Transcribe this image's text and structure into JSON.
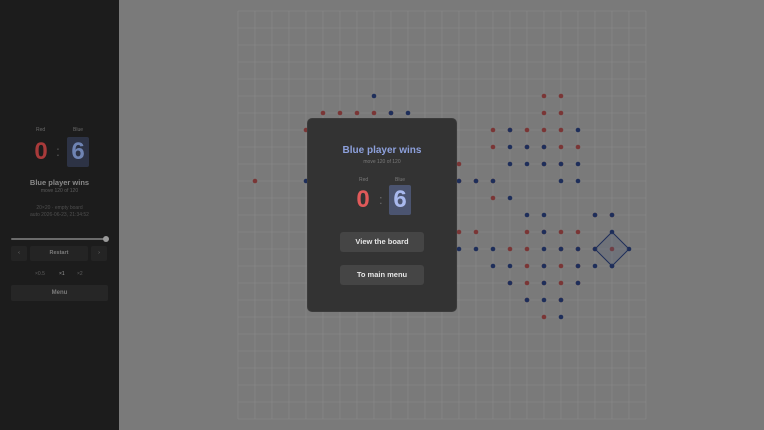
{
  "sidebar": {
    "red_label": "Red",
    "blue_label": "Blue",
    "red_score": "0",
    "blue_score": "6",
    "separator": ":",
    "result": "Blue player wins",
    "move": "move 120 of 120",
    "board_info": "20×20 · empty board",
    "date": "auto 2026-06-23, 21:34:52",
    "slider_value": 1.0,
    "prev": "‹",
    "restart": "Restart",
    "next": "›",
    "speeds": [
      "×0.5",
      "×1",
      "×2"
    ],
    "menu": "Menu"
  },
  "modal": {
    "title": "Blue player wins",
    "move": "move 120 of 120",
    "red_label": "Red",
    "blue_label": "Blue",
    "red_score": "0",
    "blue_score": "6",
    "separator": ":",
    "view_board": "View the board",
    "main_menu": "To main menu"
  },
  "colors": {
    "red_dot": "#7a3636",
    "blue_dot": "#1e2e5a",
    "grid_line": "#8a8a8a",
    "overlay": "#7a7a7a"
  },
  "board": {
    "cols": 24,
    "rows": 24,
    "red_dots": [
      [
        5,
        6
      ],
      [
        6,
        6
      ],
      [
        7,
        6
      ],
      [
        8,
        6
      ],
      [
        9,
        6
      ],
      [
        4,
        7
      ],
      [
        1,
        10
      ],
      [
        13,
        9
      ],
      [
        13,
        10
      ],
      [
        14,
        10
      ],
      [
        15,
        10
      ],
      [
        15,
        11
      ],
      [
        15,
        7
      ],
      [
        16,
        7
      ],
      [
        17,
        7
      ],
      [
        18,
        7
      ],
      [
        19,
        7
      ],
      [
        15,
        8
      ],
      [
        17,
        8
      ],
      [
        18,
        8
      ],
      [
        19,
        8
      ],
      [
        20,
        8
      ],
      [
        18,
        9
      ],
      [
        19,
        9
      ],
      [
        18,
        5
      ],
      [
        19,
        5
      ],
      [
        18,
        6
      ],
      [
        19,
        6
      ],
      [
        13,
        13
      ],
      [
        14,
        13
      ],
      [
        17,
        13
      ],
      [
        18,
        13
      ],
      [
        19,
        13
      ],
      [
        16,
        14
      ],
      [
        17,
        14
      ],
      [
        19,
        14
      ],
      [
        21,
        14
      ],
      [
        17,
        15
      ],
      [
        18,
        15
      ],
      [
        19,
        15
      ],
      [
        20,
        15
      ],
      [
        16,
        16
      ],
      [
        17,
        16
      ],
      [
        18,
        16
      ],
      [
        19,
        16
      ],
      [
        20,
        16
      ],
      [
        17,
        17
      ],
      [
        19,
        17
      ],
      [
        18,
        18
      ],
      [
        21,
        12
      ],
      [
        22,
        12
      ],
      [
        20,
        13
      ],
      [
        20,
        14
      ],
      [
        22,
        14
      ]
    ],
    "blue_dots": [
      [
        8,
        5
      ],
      [
        9,
        6
      ],
      [
        10,
        6
      ],
      [
        4,
        10
      ],
      [
        13,
        10
      ],
      [
        14,
        10
      ],
      [
        15,
        10
      ],
      [
        16,
        8
      ],
      [
        17,
        8
      ],
      [
        18,
        8
      ],
      [
        16,
        9
      ],
      [
        17,
        9
      ],
      [
        18,
        9
      ],
      [
        19,
        9
      ],
      [
        20,
        9
      ],
      [
        16,
        7
      ],
      [
        20,
        7
      ],
      [
        19,
        10
      ],
      [
        20,
        10
      ],
      [
        16,
        11
      ],
      [
        18,
        12
      ],
      [
        17,
        12
      ],
      [
        13,
        14
      ],
      [
        14,
        14
      ],
      [
        15,
        14
      ],
      [
        15,
        15
      ],
      [
        16,
        15
      ],
      [
        18,
        15
      ],
      [
        21,
        15
      ],
      [
        22,
        15
      ],
      [
        16,
        16
      ],
      [
        18,
        16
      ],
      [
        20,
        16
      ],
      [
        17,
        17
      ],
      [
        18,
        17
      ],
      [
        19,
        17
      ],
      [
        19,
        18
      ],
      [
        22,
        13
      ],
      [
        23,
        14
      ],
      [
        22,
        15
      ],
      [
        21,
        14
      ],
      [
        21,
        12
      ],
      [
        22,
        12
      ],
      [
        20,
        14
      ],
      [
        20,
        15
      ],
      [
        18,
        13
      ],
      [
        18,
        14
      ],
      [
        19,
        14
      ]
    ]
  }
}
